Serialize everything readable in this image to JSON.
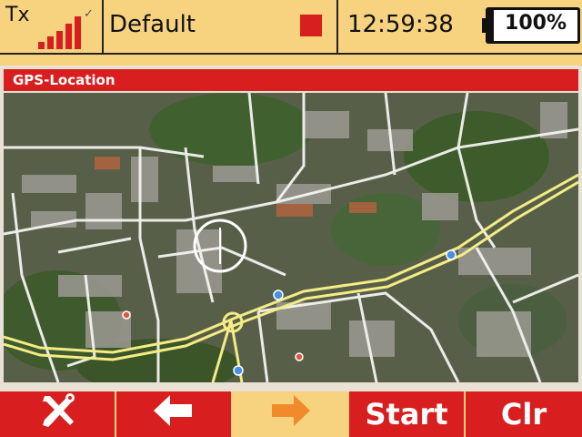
{
  "status": {
    "tx_label": "Tx",
    "signal_icon": "signal-bars-icon",
    "model_name": "Default",
    "clock": "12:59:38",
    "battery_percent": 1.0,
    "battery_label": "100%"
  },
  "panel": {
    "title": "GPS-Location",
    "map_icon": "satellite-map"
  },
  "buttons": {
    "tools_icon": "tools-icon",
    "back_icon": "arrow-left-icon",
    "forward_icon": "arrow-right-icon",
    "start_label": "Start",
    "clear_label": "Clr"
  },
  "colors": {
    "accent_red": "#d81e1e",
    "bar_yellow": "#f7d27f",
    "inactive_arrow": "#f08a2a"
  }
}
